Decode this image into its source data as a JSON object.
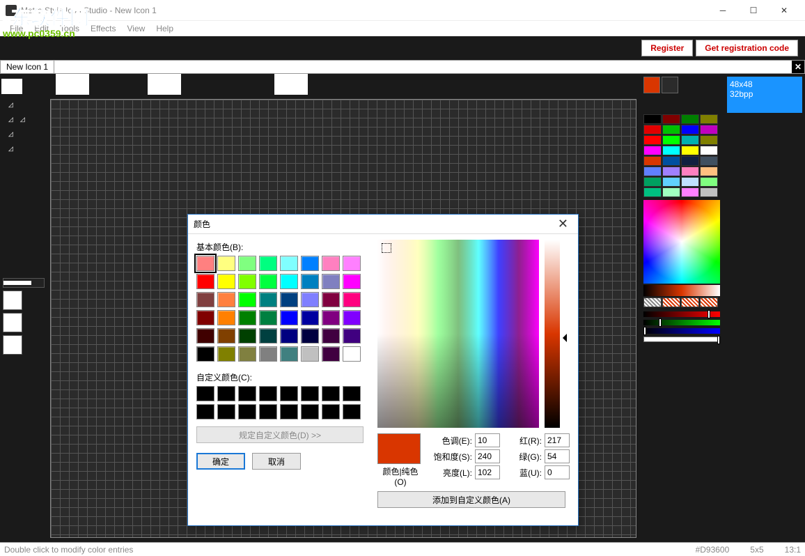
{
  "window": {
    "title": "Metro Style Icon Studio - New Icon 1",
    "menus": [
      "File",
      "Edit",
      "Tools",
      "Effects",
      "View",
      "Help"
    ],
    "register": "Register",
    "get_code": "Get registration code",
    "tab": "New Icon 1"
  },
  "watermark": {
    "text": "河东软件网",
    "url": "www.pc0359.cn"
  },
  "right": {
    "fg": "#D93600",
    "bg": "#2b2b2b",
    "info1": "48x48",
    "info2": "32bpp",
    "palette": [
      "#000000",
      "#7f0000",
      "#007f00",
      "#7f7f00",
      "#e00000",
      "#00c000",
      "#0000ff",
      "#c000c0",
      "#ff0000",
      "#00ff00",
      "#00b0b0",
      "#808000",
      "#ff00ff",
      "#00ffff",
      "#ffff00",
      "#ffffff",
      "#d93600",
      "#0050a0",
      "#102040",
      "#405060",
      "#6080ff",
      "#a080ff",
      "#ff80c0",
      "#ffc080",
      "#00a060",
      "#60d0ff",
      "#c0e0ff",
      "#80ff80",
      "#00c080",
      "#a0ffc0",
      "#ff80ff",
      "#c0c0c0"
    ]
  },
  "status": {
    "hint": "Double click to modify color entries",
    "hex": "#D93600",
    "coord": "5x5",
    "ratio": "13:1"
  },
  "dialog": {
    "title": "颜色",
    "basic_label": "基本颜色(B):",
    "custom_label": "自定义颜色(C):",
    "define": "规定自定义颜色(D) >>",
    "ok": "确定",
    "cancel": "取消",
    "color_solid": "颜色|纯色(O)",
    "hue": "色调(E):",
    "sat": "饱和度(S):",
    "lum": "亮度(L):",
    "red": "红(R):",
    "green": "绿(G):",
    "blue": "蓝(U):",
    "hue_v": "10",
    "sat_v": "240",
    "lum_v": "102",
    "red_v": "217",
    "green_v": "54",
    "blue_v": "0",
    "add": "添加到自定义颜色(A)",
    "basic": [
      [
        "#ff8080",
        "#ffff80",
        "#80ff80",
        "#00ff80",
        "#80ffff",
        "#0080ff",
        "#ff80c0",
        "#ff80ff"
      ],
      [
        "#ff0000",
        "#ffff00",
        "#80ff00",
        "#00ff40",
        "#00ffff",
        "#0080c0",
        "#8080c0",
        "#ff00ff"
      ],
      [
        "#804040",
        "#ff8040",
        "#00ff00",
        "#008080",
        "#004080",
        "#8080ff",
        "#800040",
        "#ff0080"
      ],
      [
        "#800000",
        "#ff8000",
        "#008000",
        "#008040",
        "#0000ff",
        "#0000a0",
        "#800080",
        "#8000ff"
      ],
      [
        "#400000",
        "#804000",
        "#004000",
        "#004040",
        "#000080",
        "#000040",
        "#400040",
        "#400080"
      ],
      [
        "#000000",
        "#808000",
        "#808040",
        "#808080",
        "#408080",
        "#c0c0c0",
        "#400040",
        "#ffffff"
      ]
    ]
  }
}
